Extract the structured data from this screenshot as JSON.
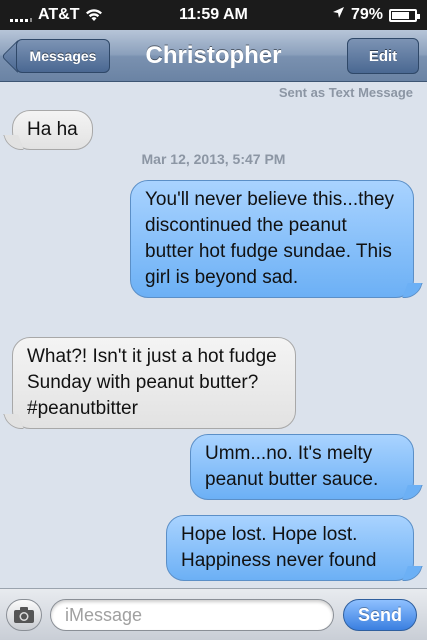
{
  "status_bar": {
    "carrier": "AT&T",
    "time": "11:59 AM",
    "battery_percent": "79%",
    "battery_level": 0.79,
    "icons": [
      "signal-icon",
      "wifi-icon",
      "location-icon",
      "battery-icon"
    ]
  },
  "nav": {
    "back_label": "Messages",
    "title": "Christopher",
    "edit_label": "Edit"
  },
  "conversation": {
    "sent_note": "Sent as Text Message",
    "timestamp": "Mar 12, 2013, 5:47 PM",
    "messages": [
      {
        "direction": "incoming",
        "text": "Ha ha"
      },
      {
        "direction": "outgoing",
        "text": "You'll never believe this...they discontinued the peanut butter hot fudge sundae. This girl is beyond sad."
      },
      {
        "direction": "incoming",
        "text": "What?! Isn't it just a hot fudge Sunday with peanut butter?  #peanutbitter"
      },
      {
        "direction": "outgoing",
        "text": "Umm...no. It's melty peanut butter sauce."
      },
      {
        "direction": "outgoing",
        "text": "Hope lost. Hope lost. Happiness never found"
      }
    ]
  },
  "input_bar": {
    "placeholder": "iMessage",
    "value": "",
    "send_label": "Send"
  },
  "colors": {
    "incoming_bubble": "#e2e2e2",
    "outgoing_bubble": "#6cb0f5",
    "nav_bar": "#7a91b0",
    "send_button": "#3a7fe0"
  }
}
